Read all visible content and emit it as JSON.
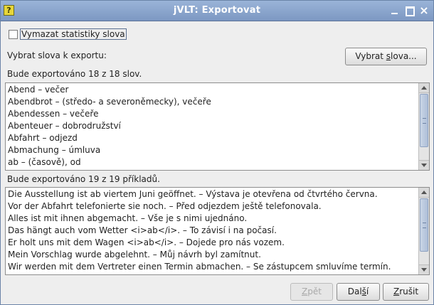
{
  "window": {
    "title": "jVLT: Exportovat",
    "app_icon_glyph": "?",
    "controls": [
      "minimize-icon",
      "maximize-icon",
      "close-icon"
    ],
    "close_glyph": "×"
  },
  "options": {
    "clear_stats_label": "Vymazat statistiky slova",
    "clear_stats_checked": false
  },
  "select": {
    "label": "Vybrat slova k exportu:",
    "button_pre": "Vybrat ",
    "button_mnemonic": "s",
    "button_post": "lova..."
  },
  "words": {
    "summary": "Bude exportováno 18 z 18 slov.",
    "items": [
      "Abend – večer",
      "Abendbrot – (středo- a severoněmecky), večeře",
      "Abendessen – večeře",
      "Abenteuer – dobrodružství",
      "Abfahrt – odjezd",
      "Abmachung – úmluva",
      "ab – (časově), od"
    ]
  },
  "examples": {
    "summary": "Bude exportováno 19 z 19 příkladů.",
    "items": [
      "Die Ausstellung ist ab viertem Juni geöffnet. – Výstava je otevřena od čtvrtého června.",
      "Vor der Abfahrt telefonierte sie noch. – Před odjezdem ještě telefonovala.",
      "Alles ist mit ihnen abgemacht. – Vše je s nimi ujednáno.",
      "Das hängt auch vom Wetter <i>ab</i>. – To závisí i na počasí.",
      "Er holt uns mit dem Wagen <i>ab</i>. – Dojede pro nás vozem.",
      "Mein Vorschlag wurde abgelehnt. – Můj návrh byl zamítnut.",
      "Wir werden mit dem Vertreter einen Termin abmachen. – Se zástupcem smluvíme termín."
    ]
  },
  "footer": {
    "back_mnemonic": "Z",
    "back_post": "pět",
    "back_enabled": false,
    "next_pre": "Dal",
    "next_mnemonic": "š",
    "next_post": "í",
    "cancel_mnemonic": "Z",
    "cancel_post": "rušit"
  }
}
